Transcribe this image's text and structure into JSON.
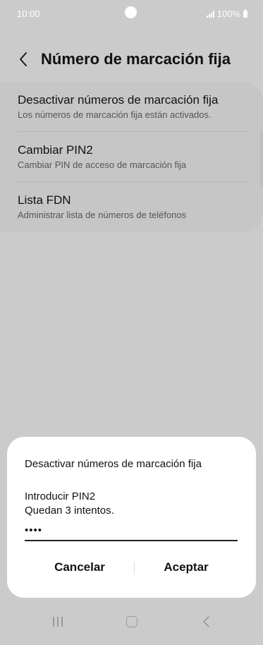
{
  "status_bar": {
    "time": "10:00",
    "battery": "100%"
  },
  "header": {
    "title": "Número de marcación fija"
  },
  "settings": {
    "items": [
      {
        "title": "Desactivar números de marcación fija",
        "subtitle": "Los números de marcación fija están activados."
      },
      {
        "title": "Cambiar PIN2",
        "subtitle": "Cambiar PIN de acceso de marcación fija"
      },
      {
        "title": "Lista FDN",
        "subtitle": "Administrar lista de números de teléfonos"
      }
    ]
  },
  "dialog": {
    "title": "Desactivar números de marcación fija",
    "prompt": "Introducir PIN2",
    "attempts": "Quedan 3 intentos.",
    "pin_value": "••••",
    "cancel_label": "Cancelar",
    "accept_label": "Aceptar"
  },
  "icons": {
    "back": "chevron-left-icon",
    "nav_recents": "recents-icon",
    "nav_home": "home-icon",
    "nav_back": "back-icon"
  }
}
